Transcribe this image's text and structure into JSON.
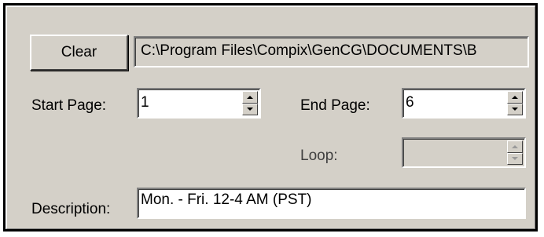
{
  "buttons": {
    "clear_label": "Clear"
  },
  "path": {
    "value": "C:\\Program Files\\Compix\\GenCG\\DOCUMENTS\\B"
  },
  "start_page": {
    "label": "Start Page:",
    "value": "1"
  },
  "end_page": {
    "label": "End Page:",
    "value": "6"
  },
  "loop": {
    "label": "Loop:",
    "value": ""
  },
  "description": {
    "label": "Description:",
    "value": "Mon. - Fri. 12-4 AM (PST)"
  },
  "icons": {
    "spin_up": "arrow-up-icon",
    "spin_down": "arrow-down-icon"
  },
  "colors": {
    "panel_bg": "#d4d0c8",
    "field_bg": "#ffffff",
    "outer_border": "#000000"
  }
}
